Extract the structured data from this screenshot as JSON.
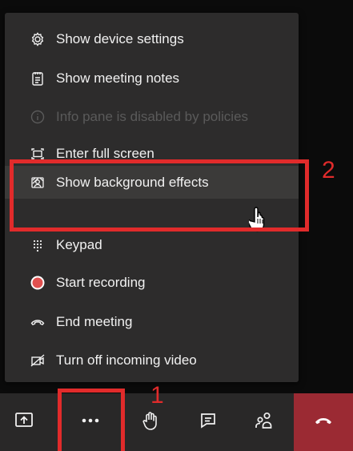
{
  "menu": {
    "items": [
      {
        "label": "Show device settings",
        "icon": "gear-icon"
      },
      {
        "label": "Show meeting notes",
        "icon": "notes-icon"
      },
      {
        "label": "Info pane is disabled by policies",
        "icon": "info-icon",
        "disabled": true
      },
      {
        "label": "Enter full screen",
        "icon": "fullscreen-icon"
      },
      {
        "label": "Show background effects",
        "icon": "background-effects-icon",
        "highlighted": true
      },
      {
        "label": "Keypad",
        "icon": "keypad-icon"
      },
      {
        "label": "Start recording",
        "icon": "record-icon"
      },
      {
        "label": "End meeting",
        "icon": "end-meeting-icon"
      },
      {
        "label": "Turn off incoming video",
        "icon": "video-off-icon"
      }
    ]
  },
  "annotations": {
    "step1": "1",
    "step2": "2"
  },
  "toolbar": {
    "share": "share-screen-icon",
    "more": "more-icon",
    "raise_hand": "raise-hand-icon",
    "chat": "chat-icon",
    "participants": "participants-icon",
    "hangup": "hangup-icon"
  },
  "colors": {
    "annotation": "#e12b2b",
    "hangup": "#9b2a33",
    "record": "#e0504f"
  }
}
